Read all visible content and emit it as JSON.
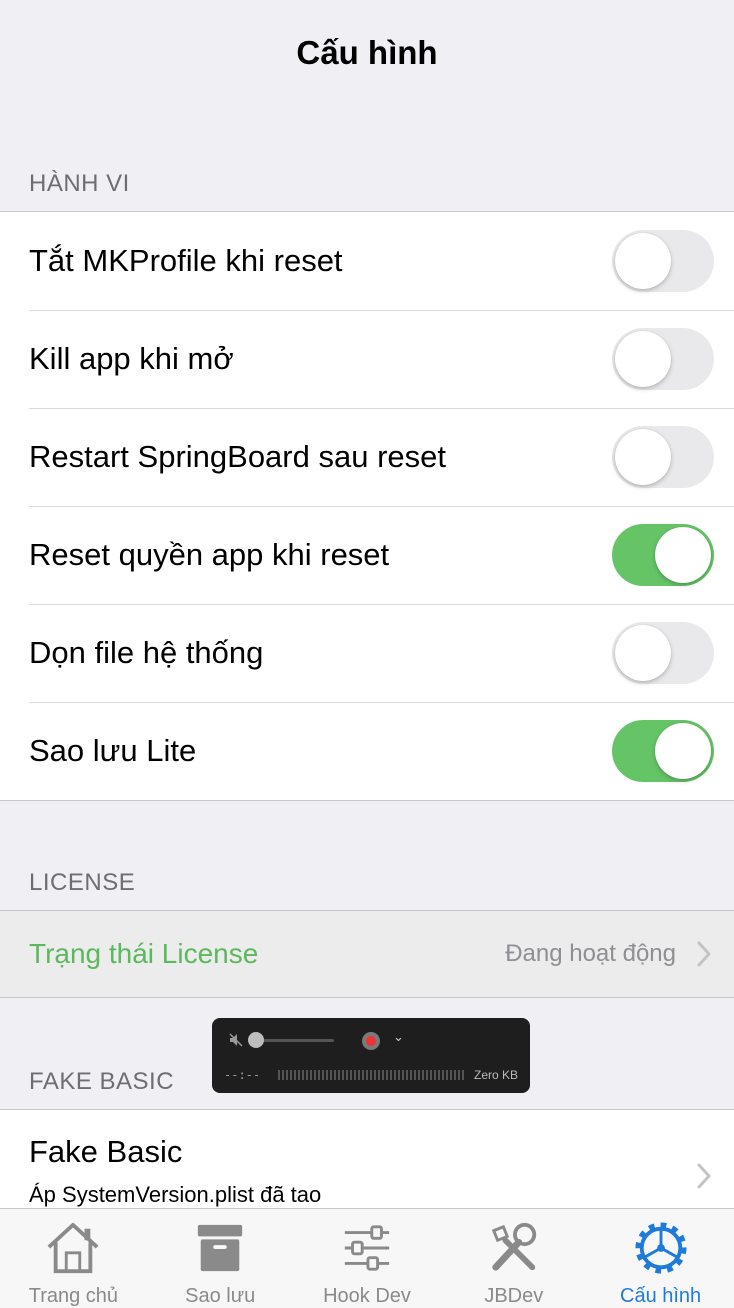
{
  "nav": {
    "title": "Cấu hình"
  },
  "sections": {
    "behavior": {
      "header": "HÀNH VI",
      "rows": [
        {
          "label": "Tắt MKProfile khi reset",
          "on": false
        },
        {
          "label": "Kill app khi mở",
          "on": false
        },
        {
          "label": "Restart SpringBoard sau reset",
          "on": false
        },
        {
          "label": "Reset quyền app khi reset",
          "on": true
        },
        {
          "label": "Dọn file hệ thống",
          "on": false
        },
        {
          "label": "Sao lưu Lite",
          "on": true
        }
      ]
    },
    "license": {
      "header": "LICENSE",
      "label": "Trạng thái License",
      "value": "Đang hoạt động"
    },
    "fake_basic": {
      "header": "FAKE BASIC",
      "title": "Fake Basic",
      "subtitle": "Áp SystemVersion.plist đã tao"
    }
  },
  "recorder_overlay": {
    "time": "--:--",
    "size": "Zero KB"
  },
  "tabbar": {
    "items": [
      {
        "label": "Trang chủ",
        "icon": "home-icon",
        "active": false
      },
      {
        "label": "Sao lưu",
        "icon": "archive-icon",
        "active": false
      },
      {
        "label": "Hook Dev",
        "icon": "sliders-icon",
        "active": false
      },
      {
        "label": "JBDev",
        "icon": "tools-icon",
        "active": false
      },
      {
        "label": "Cấu hình",
        "icon": "gear-icon",
        "active": true
      }
    ]
  },
  "colors": {
    "toggle_on": "#65c466",
    "license_text": "#5cb85c",
    "tab_active": "#1e7bd9"
  }
}
